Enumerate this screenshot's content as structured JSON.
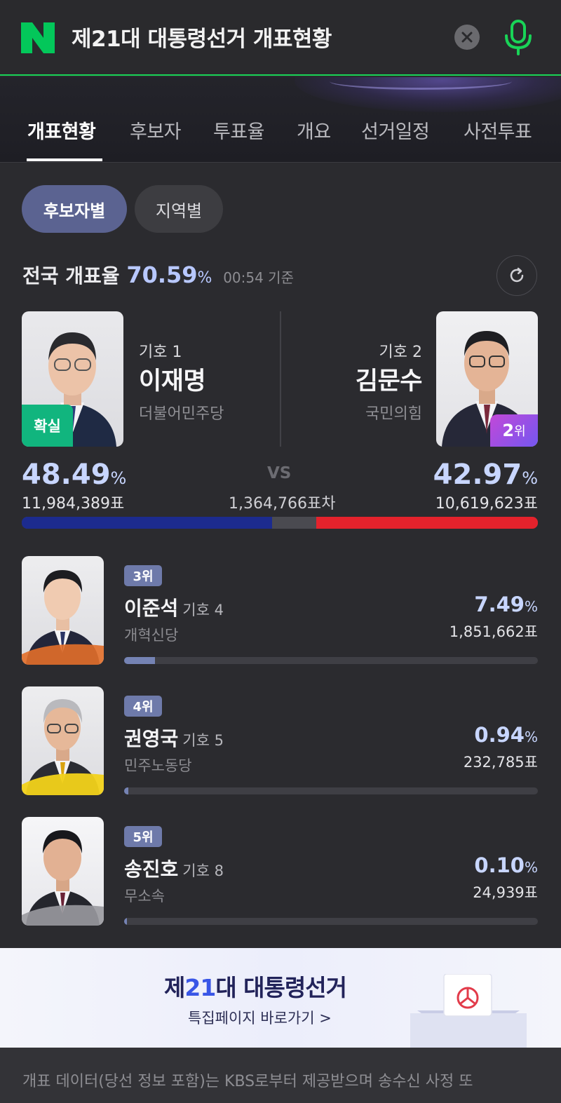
{
  "search": {
    "query": "제21대 대통령선거 개표현황"
  },
  "tabs": [
    "개표현황",
    "후보자",
    "투표율",
    "개요",
    "선거일정",
    "사전투표"
  ],
  "segments": [
    "후보자별",
    "지역별"
  ],
  "rate": {
    "label": "전국 개표율",
    "value": "70.59",
    "unit": "%",
    "time": "00:54 기준"
  },
  "top2": {
    "left": {
      "num": "기호 1",
      "name": "이재명",
      "party": "더불어민주당",
      "badge": "확실",
      "pct": "48.49",
      "votes": "11,984,389표",
      "share": 48.49
    },
    "right": {
      "num": "기호 2",
      "name": "김문수",
      "party": "국민의힘",
      "badge_rank": "2",
      "badge_unit": "위",
      "pct": "42.97",
      "votes": "10,619,623표",
      "share": 42.97
    },
    "vs": "VS",
    "diff": "1,364,766표차"
  },
  "pct_unit": "%",
  "others": [
    {
      "rank": "3위",
      "name": "이준석",
      "num": "기호 4",
      "party": "개혁신당",
      "pct": "7.49",
      "votes": "1,851,662표",
      "share": 7.49
    },
    {
      "rank": "4위",
      "name": "권영국",
      "num": "기호 5",
      "party": "민주노동당",
      "pct": "0.94",
      "votes": "232,785표",
      "share": 0.94
    },
    {
      "rank": "5위",
      "name": "송진호",
      "num": "기호 8",
      "party": "무소속",
      "pct": "0.10",
      "votes": "24,939표",
      "share": 0.1
    }
  ],
  "banner": {
    "title_prefix": "제",
    "title_accent": "21",
    "title_suffix": "대 대통령선거",
    "sub": "특집페이지 바로가기 >"
  },
  "footer": {
    "text": "개표 데이터(당선 정보 포함)는 KBS로부터 제공받으며 송수신 사정 또"
  },
  "colors": {
    "brand_green": "#03c75a",
    "blue_party": "#1c2b8e",
    "red_party": "#e4222c",
    "accent": "#c8d6ff"
  }
}
